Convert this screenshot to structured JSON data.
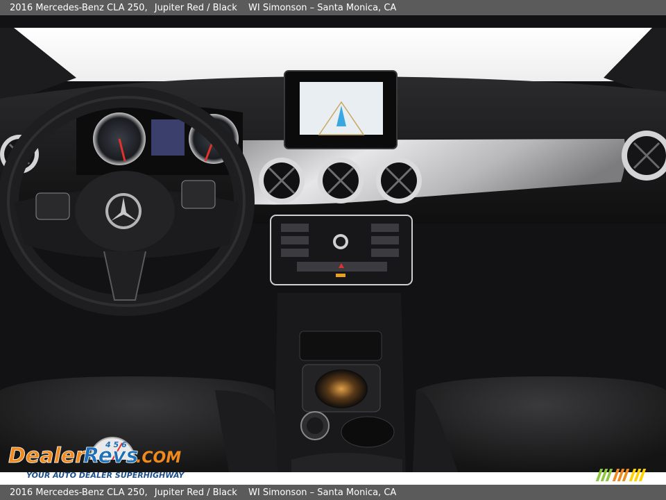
{
  "caption": {
    "vehicle": "2016 Mercedes-Benz CLA 250,",
    "color": "Jupiter Red / Black",
    "dealer": "WI Simonson – Santa Monica, CA"
  },
  "watermark": {
    "brand_dealer": "Dealer",
    "brand_revs": "Revs",
    "brand_com": ".COM",
    "tagline": "YOUR AUTO DEALER SUPERHIGHWAY",
    "gauge_digits": "4 5 6",
    "colors": {
      "orange": "#f08a1c",
      "blue": "#1d6fb8",
      "green": "#8dc63f"
    }
  },
  "photo": {
    "subject": "car-interior-dashboard"
  }
}
